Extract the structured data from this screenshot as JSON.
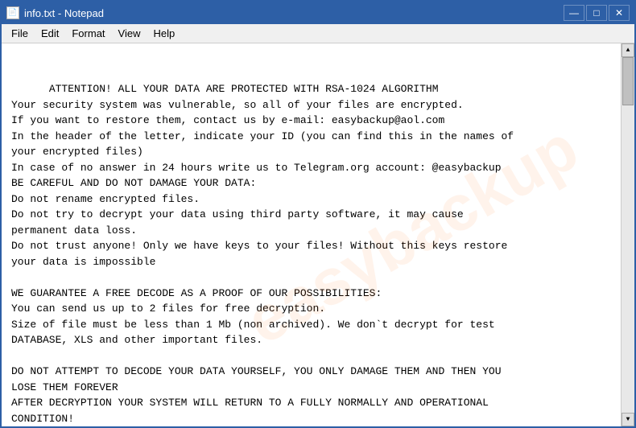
{
  "window": {
    "title": "info.txt - Notepad",
    "icon_label": "📄"
  },
  "title_controls": {
    "minimize": "—",
    "maximize": "□",
    "close": "✕"
  },
  "menu": {
    "items": [
      "File",
      "Edit",
      "Format",
      "View",
      "Help"
    ]
  },
  "content": {
    "text": "ATTENTION! ALL YOUR DATA ARE PROTECTED WITH RSA-1024 ALGORITHM\nYour security system was vulnerable, so all of your files are encrypted.\nIf you want to restore them, contact us by e-mail: easybackup@aol.com\nIn the header of the letter, indicate your ID (you can find this in the names of\nyour encrypted files)\nIn case of no answer in 24 hours write us to Telegram.org account: @easybackup\nBE CAREFUL AND DO NOT DAMAGE YOUR DATA:\nDo not rename encrypted files.\nDo not try to decrypt your data using third party software, it may cause\npermanent data loss.\nDo not trust anyone! Only we have keys to your files! Without this keys restore\nyour data is impossible\n\nWE GUARANTEE A FREE DECODE AS A PROOF OF OUR POSSIBILITIES:\nYou can send us up to 2 files for free decryption.\nSize of file must be less than 1 Mb (non archived). We don`t decrypt for test\nDATABASE, XLS and other important files.\n\nDO NOT ATTEMPT TO DECODE YOUR DATA YOURSELF, YOU ONLY DAMAGE THEM AND THEN YOU\nLOSE THEM FOREVER\nAFTER DECRYPTION YOUR SYSTEM WILL RETURN TO A FULLY NORMALLY AND OPERATIONAL\nCONDITION!",
    "watermark": "easybackup"
  }
}
